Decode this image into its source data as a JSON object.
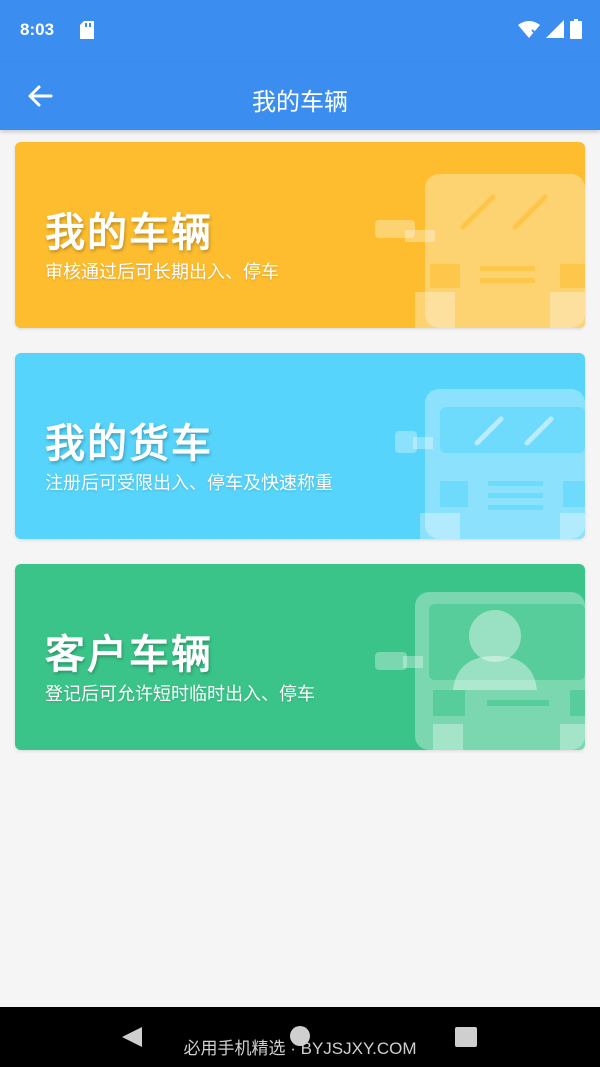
{
  "status_bar": {
    "time": "8:03",
    "icons": [
      "sd-card-icon",
      "wifi-icon",
      "signal-icon",
      "battery-icon"
    ]
  },
  "app_bar": {
    "title": "我的车辆",
    "back_icon": "arrow-left-icon"
  },
  "cards": [
    {
      "title": "我的车辆",
      "subtitle": "审核通过后可长期出入、停车",
      "color": "#fdbd2e",
      "icon": "car-icon"
    },
    {
      "title": "我的货车",
      "subtitle": "注册后可受限出入、停车及快速称重",
      "color": "#56d4fb",
      "icon": "truck-icon"
    },
    {
      "title": "客户车辆",
      "subtitle": "登记后可允许短时临时出入、停车",
      "color": "#3bc48a",
      "icon": "customer-car-icon"
    }
  ],
  "nav_bar": {
    "icons": [
      "nav-back-icon",
      "nav-home-icon",
      "nav-recent-icon"
    ]
  },
  "watermark": "必用手机精选 · BYJSJXY.COM",
  "colors": {
    "primary": "#3b8ef0",
    "background": "#f5f5f5"
  }
}
